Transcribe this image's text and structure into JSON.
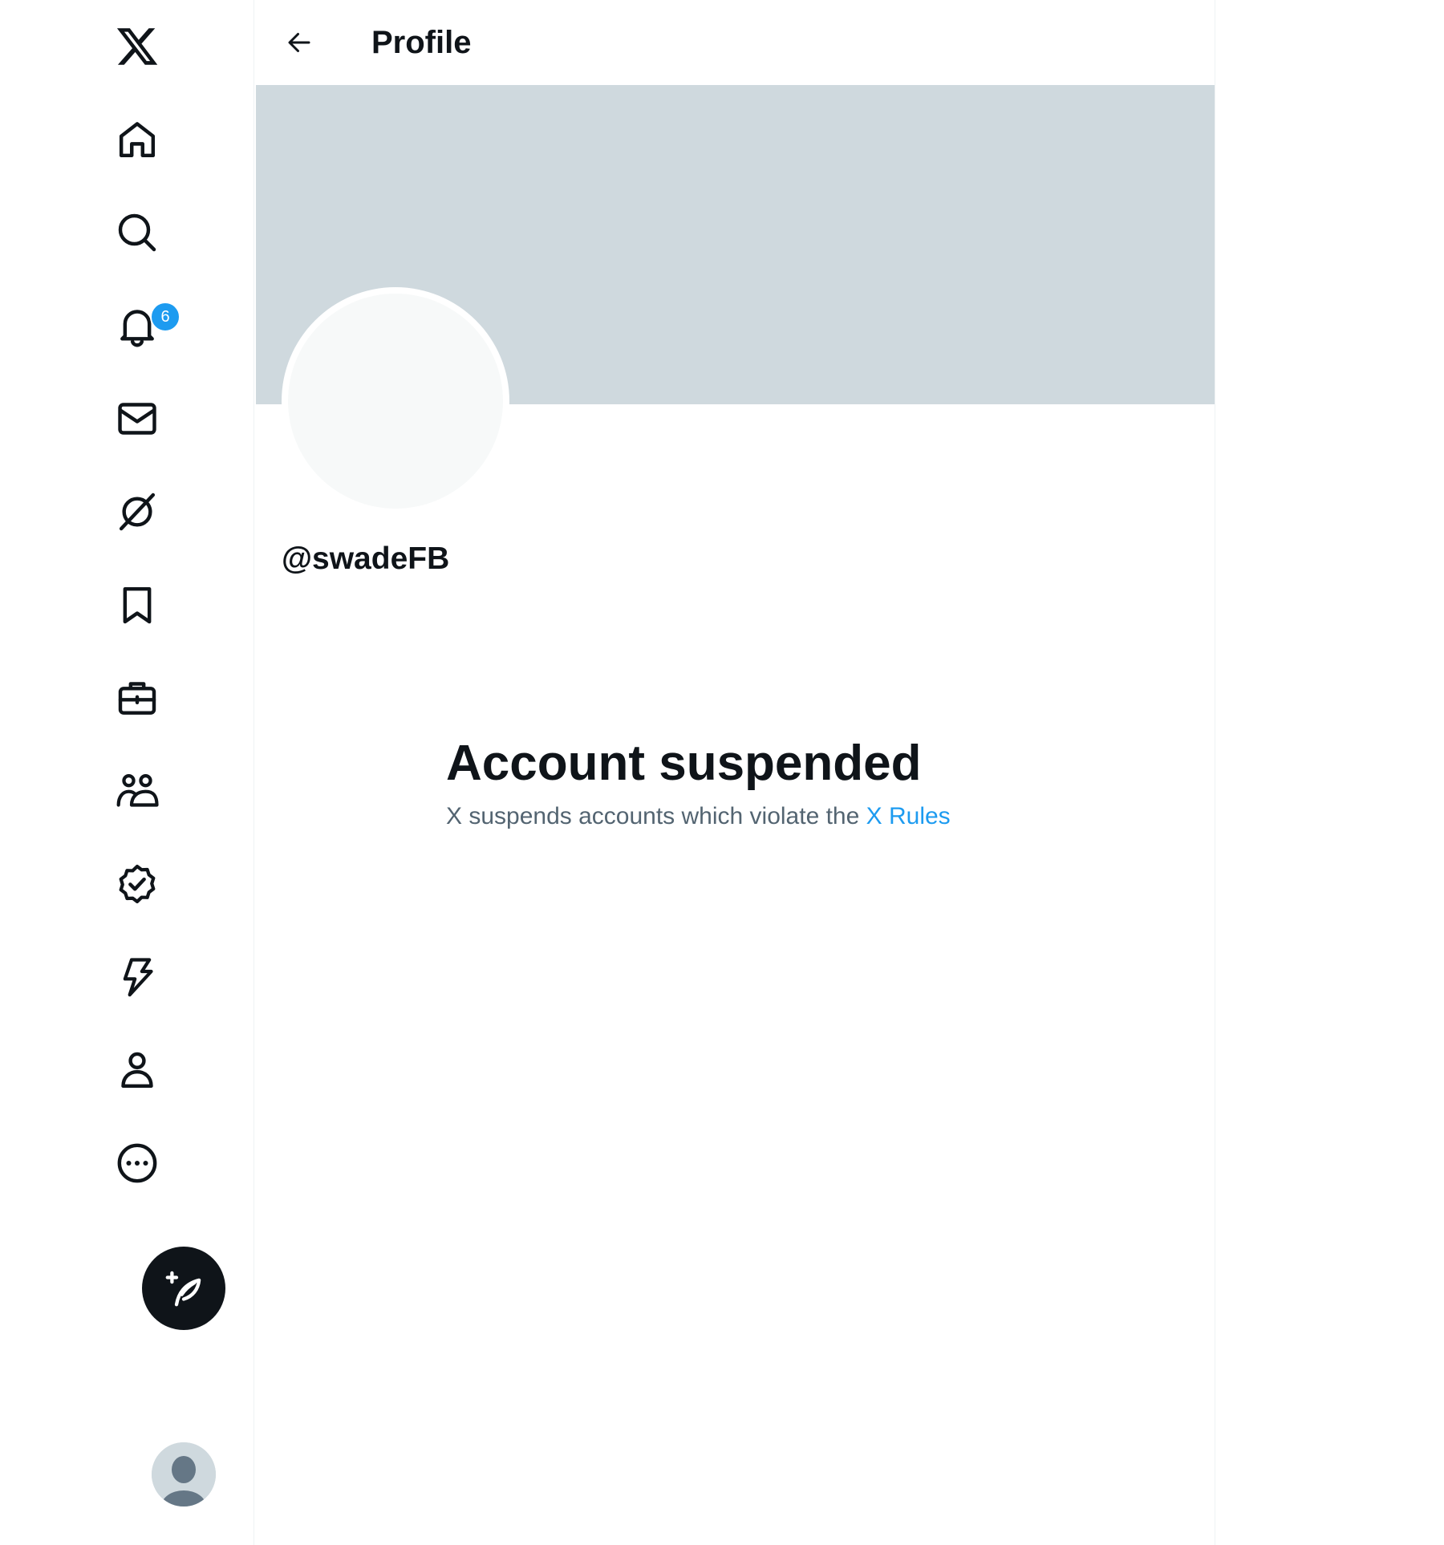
{
  "header": {
    "title": "Profile",
    "back_icon": "arrow-left-icon"
  },
  "nav": {
    "items": [
      {
        "icon": "x-logo-icon"
      },
      {
        "icon": "home-icon"
      },
      {
        "icon": "search-icon"
      },
      {
        "icon": "bell-icon",
        "badge": "6"
      },
      {
        "icon": "envelope-icon"
      },
      {
        "icon": "grok-icon"
      },
      {
        "icon": "bookmark-icon"
      },
      {
        "icon": "briefcase-icon"
      },
      {
        "icon": "communities-icon"
      },
      {
        "icon": "verified-icon"
      },
      {
        "icon": "lightning-icon"
      },
      {
        "icon": "person-icon"
      },
      {
        "icon": "more-icon"
      }
    ],
    "compose_icon": "feather-plus-icon",
    "account_icon": "avatar-icon"
  },
  "profile": {
    "handle": "@swadeFB"
  },
  "suspension": {
    "title": "Account suspended",
    "message": "X suspends accounts which violate the ",
    "link_text": "X Rules"
  },
  "colors": {
    "accent": "#1d9bf0",
    "banner": "#cfd9de",
    "text_primary": "#0f1419",
    "text_secondary": "#536471",
    "compose_bg": "#0f1419"
  }
}
